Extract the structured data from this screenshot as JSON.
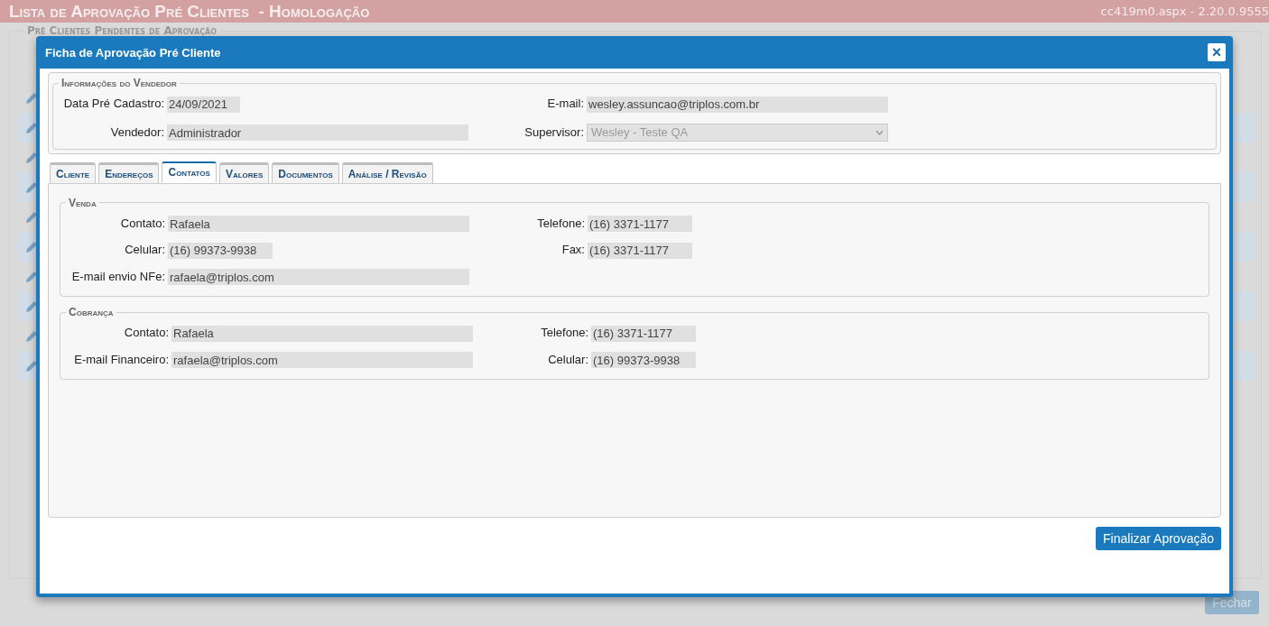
{
  "page": {
    "title": "Lista de Aprovação Pré Clientes",
    "subtitle": "- Homologação",
    "version": "cc419m0.aspx - 2.20.0.9555",
    "panel_title": "Pré Clientes Pendentes de Aprovação",
    "rows": [
      {
        "selected": false
      },
      {
        "selected": true
      },
      {
        "selected": false
      },
      {
        "selected": true
      },
      {
        "selected": false
      },
      {
        "selected": true
      },
      {
        "selected": false
      },
      {
        "selected": true
      },
      {
        "selected": false
      },
      {
        "selected": true
      }
    ],
    "close_button": "Fechar"
  },
  "dialog": {
    "title": "Ficha de Aprovação Pré Cliente",
    "close": "×",
    "vendor": {
      "legend": "Informações do Vendedor",
      "fields": [
        {
          "label": "Data Pré Cadastro:",
          "value": "24/09/2021",
          "kind": "short"
        },
        {
          "label": "E-mail:",
          "value": "wesley.assuncao@triplos.com.br",
          "kind": "long"
        },
        {
          "label": "Vendedor:",
          "value": "Administrador",
          "kind": "wide"
        },
        {
          "label": "Supervisor:",
          "value": "Wesley - Teste QA",
          "kind": "select"
        }
      ]
    },
    "tabs": [
      {
        "label": "Cliente",
        "selected": false
      },
      {
        "label": "Endereços",
        "selected": false
      },
      {
        "label": "Contatos",
        "selected": true
      },
      {
        "label": "Valores",
        "selected": false
      },
      {
        "label": "Documentos",
        "selected": false
      },
      {
        "label": "Análise / Revisão",
        "selected": false
      }
    ],
    "sections": [
      {
        "legend": "Venda",
        "fields": [
          {
            "label": "Contato:",
            "value": "Rafaela",
            "kind": "wide"
          },
          {
            "label": "Telefone:",
            "value": "(16) 3371-1177",
            "kind": "phone"
          },
          {
            "label": "Celular:",
            "value": "(16) 99373-9938",
            "kind": "phone"
          },
          {
            "label": "Fax:",
            "value": "(16) 3371-1177",
            "kind": "phone"
          },
          {
            "label": "E-mail envio NFe:",
            "value": "rafaela@triplos.com",
            "kind": "wide"
          }
        ]
      },
      {
        "legend": "Cobrança",
        "fields": [
          {
            "label": "Contato:",
            "value": "Rafaela",
            "kind": "wide"
          },
          {
            "label": "Telefone:",
            "value": "(16) 3371-1177",
            "kind": "phone"
          },
          {
            "label": "E-mail Financeiro:",
            "value": "rafaela@triplos.com",
            "kind": "wide"
          },
          {
            "label": "Celular:",
            "value": "(16) 99373-9938",
            "kind": "phone"
          }
        ]
      }
    ],
    "submit": "Finalizar Aprovação"
  }
}
